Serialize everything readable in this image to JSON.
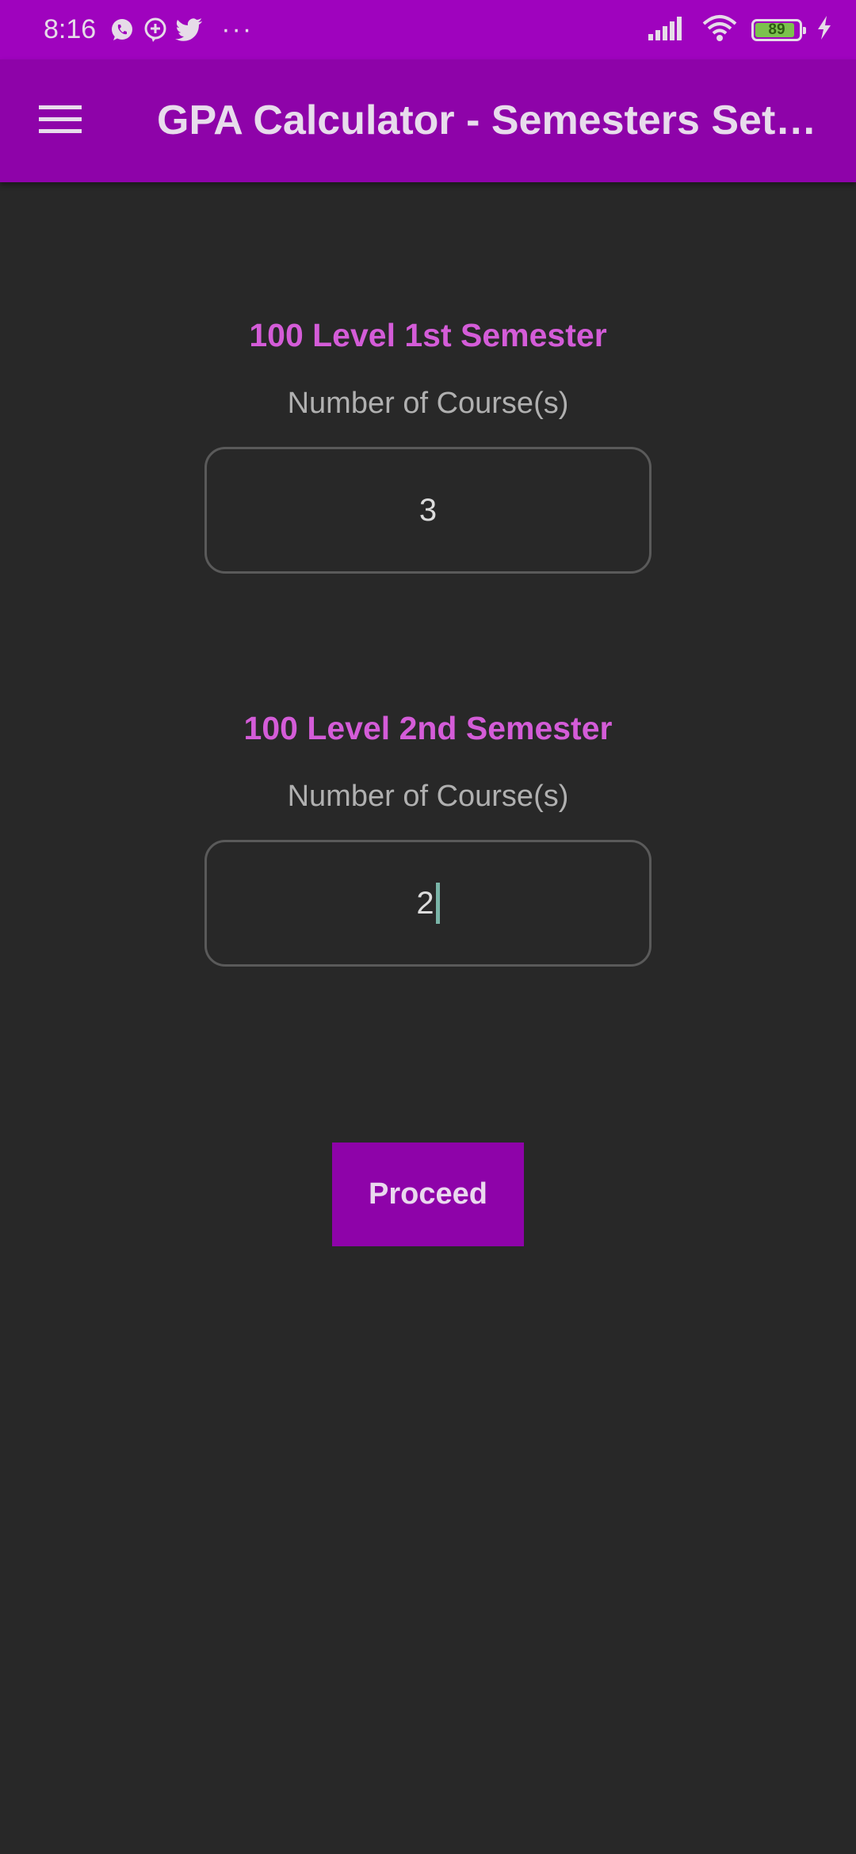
{
  "status_bar": {
    "time": "8:16",
    "icons": [
      "whatsapp-icon",
      "chat-plus-icon",
      "twitter-icon",
      "more-dots-icon"
    ],
    "more": "···",
    "battery_level": "89",
    "right_icons": [
      "signal-icon",
      "wifi-icon",
      "battery-icon",
      "charging-icon"
    ]
  },
  "app_bar": {
    "menu_icon": "hamburger-menu-icon",
    "title": "GPA Calculator - Semesters Set…"
  },
  "semesters": [
    {
      "title": "100 Level 1st Semester",
      "field_label": "Number of Course(s)",
      "value": "3"
    },
    {
      "title": "100 Level 2nd Semester",
      "field_label": "Number of Course(s)",
      "value": "2"
    }
  ],
  "proceed_label": "Proceed",
  "colors": {
    "status_bar": "#9f03be",
    "app_bar": "#8e03a9",
    "background": "#282828",
    "semester_title": "#d45cd8",
    "button": "#8e03a9"
  }
}
